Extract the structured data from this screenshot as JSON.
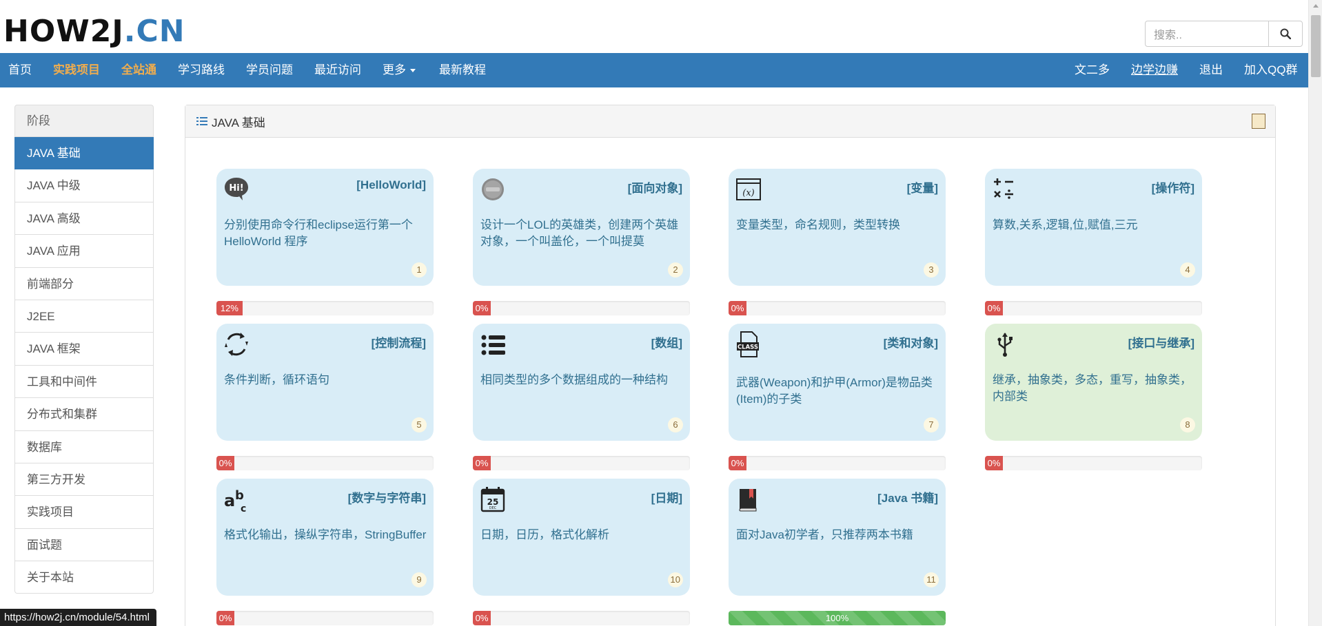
{
  "logo": {
    "part1": "HOW2J",
    "part2": ".CN"
  },
  "search": {
    "placeholder": "搜索.."
  },
  "nav": {
    "left": [
      "首页",
      "实践项目",
      "全站通",
      "学习路线",
      "学员问题",
      "最近访问",
      "更多",
      "最新教程"
    ],
    "right": [
      "文二多",
      "边学边赚",
      "退出",
      "加入QQ群"
    ]
  },
  "sidebar": {
    "header": "阶段",
    "items": [
      "JAVA 基础",
      "JAVA 中级",
      "JAVA 高级",
      "JAVA 应用",
      "前端部分",
      "J2EE",
      "JAVA 框架",
      "工具和中间件",
      "分布式和集群",
      "数据库",
      "第三方开发",
      "实践项目",
      "面试题",
      "关于本站"
    ]
  },
  "panel": {
    "title": "JAVA 基础"
  },
  "cards": [
    {
      "title": "[HelloWorld]",
      "desc": "分别使用命令行和eclipse运行第一个HelloWorld 程序",
      "num": "1",
      "progress_label": "12%",
      "progress": 12,
      "icon": "hi-bubble-icon"
    },
    {
      "title": "[面向对象]",
      "desc": "设计一个LOL的英雄类，创建两个英雄对象，一个叫盖伦，一个叫提莫",
      "num": "2",
      "progress_label": "0%",
      "progress": 0,
      "icon": "lol-logo-icon"
    },
    {
      "title": "[变量]",
      "desc": "变量类型，命名规则，类型转换",
      "num": "3",
      "progress_label": "0%",
      "progress": 0,
      "icon": "variable-icon"
    },
    {
      "title": "[操作符]",
      "desc": "算数,关系,逻辑,位,赋值,三元",
      "num": "4",
      "progress_label": "0%",
      "progress": 0,
      "icon": "operators-icon"
    },
    {
      "title": "[控制流程]",
      "desc": "条件判断，循环语句",
      "num": "5",
      "progress_label": "0%",
      "progress": 0,
      "icon": "loop-icon"
    },
    {
      "title": "[数组]",
      "desc": "相同类型的多个数据组成的一种结构",
      "num": "6",
      "progress_label": "0%",
      "progress": 0,
      "icon": "list-icon"
    },
    {
      "title": "[类和对象]",
      "desc": "武器(Weapon)和护甲(Armor)是物品类(Item)的子类",
      "num": "7",
      "progress_label": "0%",
      "progress": 0,
      "icon": "class-file-icon"
    },
    {
      "title": "[接口与继承]",
      "desc": "继承，抽象类，多态，重写，抽象类，内部类",
      "num": "8",
      "progress_label": "0%",
      "progress": 0,
      "icon": "usb-icon"
    },
    {
      "title": "[数字与字符串]",
      "desc": "格式化输出，操纵字符串，StringBuffer",
      "num": "9",
      "progress_label": "0%",
      "progress": 0,
      "icon": "abc-icon"
    },
    {
      "title": "[日期]",
      "desc": "日期，日历，格式化解析",
      "num": "10",
      "progress_label": "0%",
      "progress": 0,
      "icon": "calendar-icon"
    },
    {
      "title": "[Java 书籍]",
      "desc": "面对Java初学者，只推荐两本书籍",
      "num": "11",
      "progress_label": "100%",
      "progress": 100,
      "icon": "book-icon"
    }
  ],
  "icon_text": {
    "hi": "Hi!",
    "variable": "(x)",
    "calendar": "25",
    "calendar_sub": "DEC",
    "class": "CLASS",
    "abc_a": "a",
    "abc_b": "b",
    "abc_c": "c"
  },
  "statusbar": {
    "url": "https://how2j.cn/module/54.html"
  },
  "colors": {
    "navbar": "#337ab7",
    "highlight": "#f0ad4e",
    "card": "#d9edf7",
    "card_green": "#dff0d8",
    "progress_empty": "#d9534f",
    "progress_full": "#5cb85c"
  }
}
